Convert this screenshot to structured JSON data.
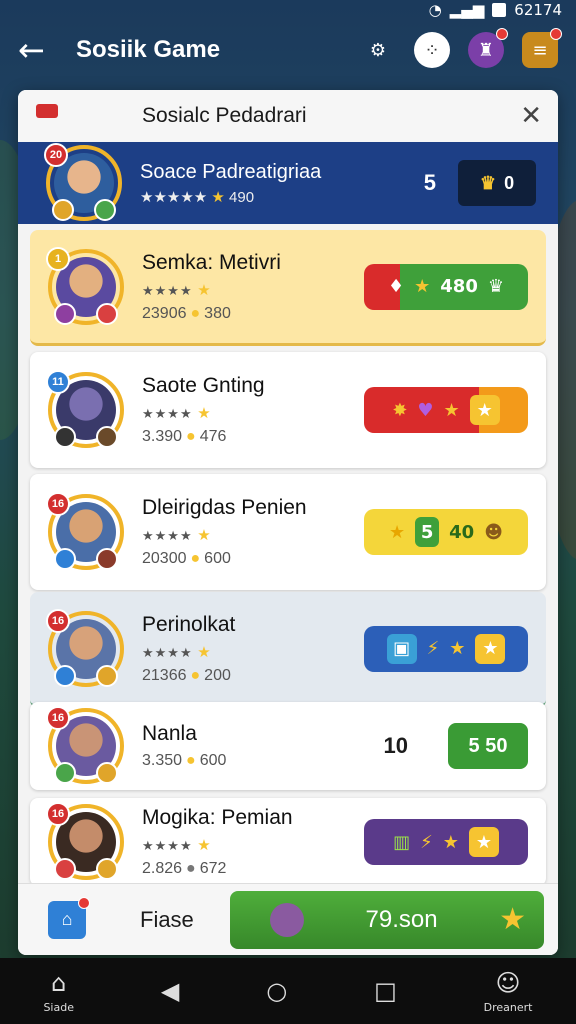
{
  "status": {
    "time": "62174"
  },
  "appbar": {
    "title": "Sosiik Game",
    "icons": [
      "settings-icon",
      "community-icon",
      "notifications-icon",
      "coins-icon"
    ]
  },
  "panel": {
    "title": "Sosialc Pedadrari",
    "close": "✕",
    "you": {
      "level": "20",
      "name": "Soace Padreatigriaa",
      "stars": "★★★★★",
      "score": "490",
      "rank": "5",
      "badge": "0"
    },
    "rows": [
      {
        "level": "1",
        "name": "Semka: Metivri",
        "stars": "★★★★",
        "score": "23906",
        "coins": "380",
        "reward": "480",
        "style": "red-green"
      },
      {
        "level": "11",
        "name": "Saote Gnting",
        "stars": "★★★★",
        "score": "3.390",
        "coins": "476",
        "style": "red-orange"
      },
      {
        "level": "16",
        "name": "Dleirigdas Penien",
        "stars": "★★★★",
        "score": "20300",
        "coins": "600",
        "reward_a": "5",
        "reward_b": "40",
        "style": "yellow"
      },
      {
        "level": "16",
        "name": "Perinolkat",
        "stars": "★★★★",
        "score": "21366",
        "coins": "200",
        "style": "blue"
      },
      {
        "level": "16",
        "name": "Nanla",
        "stars": "",
        "score": "3.350",
        "coins": "600",
        "rank": "10",
        "button": "5 50"
      },
      {
        "level": "16",
        "name": "Mogika: Pemian",
        "stars": "★★★★",
        "score": "2.826",
        "coins": "672",
        "style": "purple"
      }
    ],
    "footer": {
      "label": "Fiase",
      "button": "79.son"
    }
  },
  "nav": {
    "home": "Siade",
    "profile": "Dreanert"
  },
  "colors": {
    "accent_blue": "#1d3f86",
    "gold": "#f6c431",
    "green": "#3a9b35"
  }
}
